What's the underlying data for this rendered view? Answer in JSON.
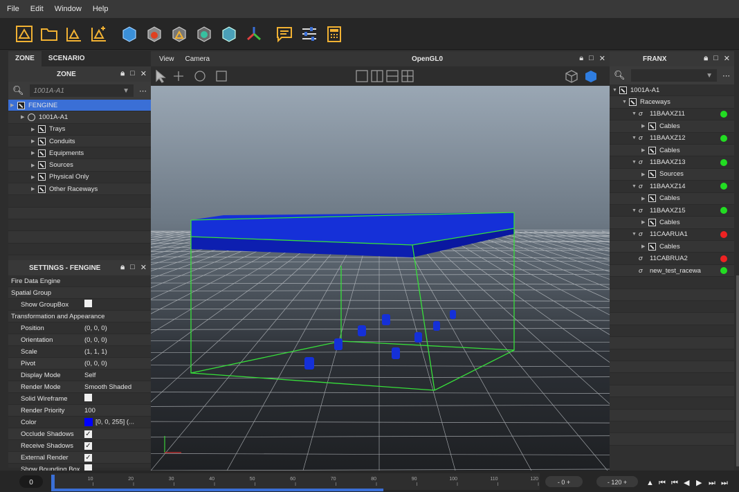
{
  "menu": [
    "File",
    "Edit",
    "Window",
    "Help"
  ],
  "toolbar_icons": [
    "new-zone-icon",
    "open-folder-icon",
    "zone-icon",
    "zone-plus-icon",
    "cube-icon",
    "fire-cube-icon",
    "alert-cube-icon",
    "green-cube-icon",
    "teal-cube-icon",
    "axes-icon",
    "message-icon",
    "sliders-icon",
    "calculator-icon"
  ],
  "left": {
    "tabs": [
      "ZONE",
      "SCENARIO"
    ],
    "panel_title": "ZONE",
    "search_value": "1001A-A1",
    "tree": [
      {
        "label": "FENGINE",
        "level": 0,
        "selected": true
      },
      {
        "label": "1001A-A1",
        "level": 1
      },
      {
        "label": "Trays",
        "level": 2
      },
      {
        "label": "Conduits",
        "level": 2
      },
      {
        "label": "Equipments",
        "level": 2
      },
      {
        "label": "Sources",
        "level": 2
      },
      {
        "label": "Physical Only",
        "level": 2
      },
      {
        "label": "Other Raceways",
        "level": 2
      }
    ]
  },
  "settings": {
    "title": "SETTINGS - FENGINE",
    "rows": [
      {
        "k": "Fire Data Engine",
        "grp": true
      },
      {
        "k": "Spatial Group",
        "grp": true
      },
      {
        "k": "Show GroupBox",
        "check": true,
        "checked": false
      },
      {
        "k": "Transformation and Appearance",
        "grp": true
      },
      {
        "k": "Position",
        "v": "(0, 0, 0)"
      },
      {
        "k": "Orientation",
        "v": "(0, 0, 0)"
      },
      {
        "k": "Scale",
        "v": "(1, 1, 1)"
      },
      {
        "k": "Pivot",
        "v": "(0, 0, 0)"
      },
      {
        "k": "Display Mode",
        "v": "Self"
      },
      {
        "k": "Render Mode",
        "v": "Smooth Shaded"
      },
      {
        "k": "Solid Wireframe",
        "check": true,
        "checked": false
      },
      {
        "k": "Render Priority",
        "v": "100"
      },
      {
        "k": "Color",
        "v": "[0, 0, 255] (...",
        "color": "#0000ff"
      },
      {
        "k": "Occlude Shadows",
        "check": true,
        "checked": true
      },
      {
        "k": "Receive Shadows",
        "check": true,
        "checked": true
      },
      {
        "k": "External Render",
        "check": true,
        "checked": true
      },
      {
        "k": "Show Bounding Box",
        "check": true,
        "checked": false
      }
    ]
  },
  "viewport": {
    "menu": [
      "View",
      "Camera"
    ],
    "title": "OpenGL0"
  },
  "right": {
    "title": "FRANX",
    "tree": [
      {
        "label": "1001A-A1",
        "level": 0,
        "type": "s",
        "arrow": true
      },
      {
        "label": "Raceways",
        "level": 1,
        "type": "s",
        "arrow": true
      },
      {
        "label": "11BAAXZ11",
        "level": 2,
        "type": "r",
        "arrow": true,
        "status": "green"
      },
      {
        "label": "Cables",
        "level": 3,
        "type": "s",
        "arrow": true
      },
      {
        "label": "11BAAXZ12",
        "level": 2,
        "type": "r",
        "arrow": true,
        "status": "green"
      },
      {
        "label": "Cables",
        "level": 3,
        "type": "s",
        "arrow": true
      },
      {
        "label": "11BAAXZ13",
        "level": 2,
        "type": "r",
        "arrow": true,
        "status": "green"
      },
      {
        "label": "Sources",
        "level": 3,
        "type": "s",
        "arrow": true
      },
      {
        "label": "11BAAXZ14",
        "level": 2,
        "type": "r",
        "arrow": true,
        "status": "green"
      },
      {
        "label": "Cables",
        "level": 3,
        "type": "s",
        "arrow": true
      },
      {
        "label": "11BAAXZ15",
        "level": 2,
        "type": "r",
        "arrow": true,
        "status": "green"
      },
      {
        "label": "Cables",
        "level": 3,
        "type": "s",
        "arrow": true
      },
      {
        "label": "11CAARUA1",
        "level": 2,
        "type": "r",
        "arrow": true,
        "status": "red"
      },
      {
        "label": "Cables",
        "level": 3,
        "type": "s",
        "arrow": true
      },
      {
        "label": "11CABRUA2",
        "level": 2,
        "type": "r",
        "arrow": false,
        "status": "red"
      },
      {
        "label": "new_test_racewa",
        "level": 2,
        "type": "r",
        "arrow": false,
        "status": "green"
      }
    ]
  },
  "timeline": {
    "current": "0",
    "ticks": [
      "10",
      "20",
      "30",
      "40",
      "50",
      "60",
      "70",
      "80",
      "90",
      "100",
      "110",
      "120"
    ],
    "start": "0",
    "end": "120",
    "progress_fraction": 0.68
  },
  "colors": {
    "green": "#22dd22",
    "red": "#ee2222",
    "select": "#3a6fd6",
    "accent": "#f2b233"
  }
}
